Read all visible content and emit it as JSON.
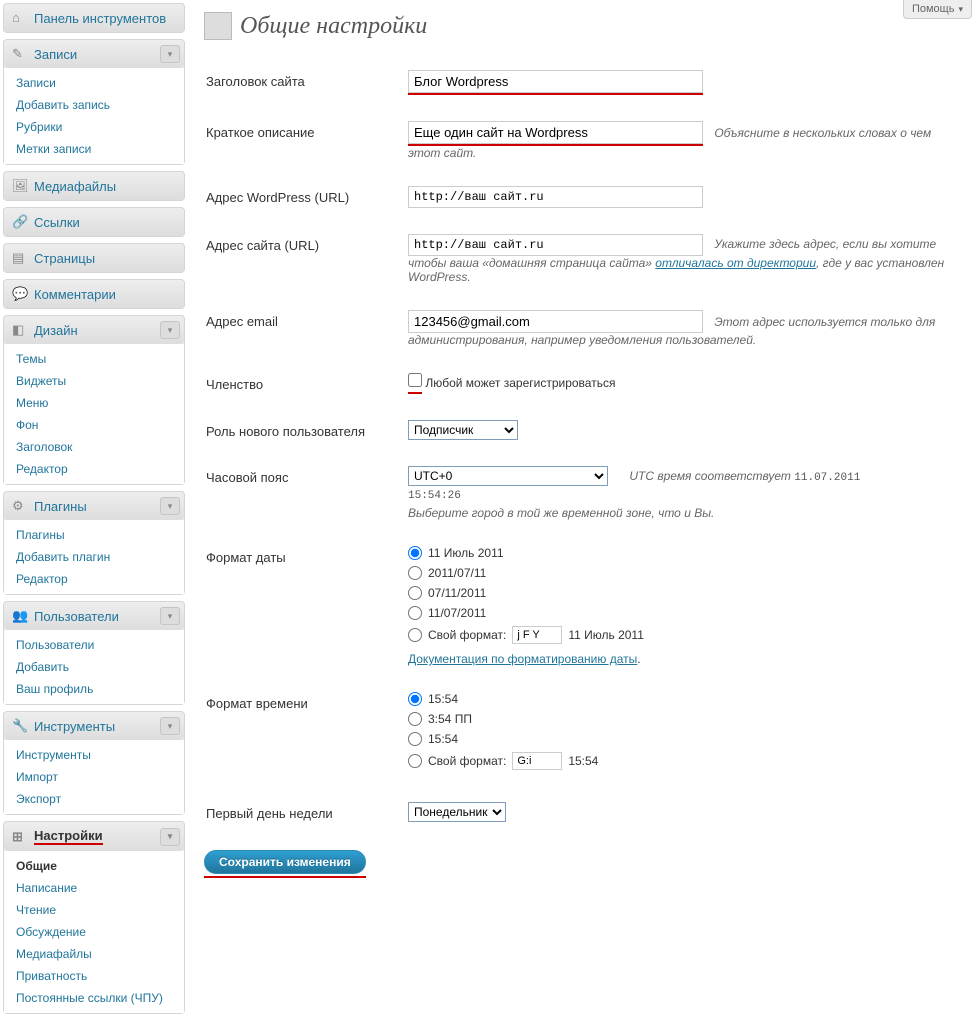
{
  "help_tab": "Помощь",
  "page_title": "Общие настройки",
  "sidebar": {
    "dashboard": "Панель инструментов",
    "posts": {
      "label": "Записи",
      "items": [
        "Записи",
        "Добавить запись",
        "Рубрики",
        "Метки записи"
      ]
    },
    "media": "Медиафайлы",
    "links": "Ссылки",
    "pages": "Страницы",
    "comments": "Комментарии",
    "appearance": {
      "label": "Дизайн",
      "items": [
        "Темы",
        "Виджеты",
        "Меню",
        "Фон",
        "Заголовок",
        "Редактор"
      ]
    },
    "plugins": {
      "label": "Плагины",
      "items": [
        "Плагины",
        "Добавить плагин",
        "Редактор"
      ]
    },
    "users": {
      "label": "Пользователи",
      "items": [
        "Пользователи",
        "Добавить",
        "Ваш профиль"
      ]
    },
    "tools": {
      "label": "Инструменты",
      "items": [
        "Инструменты",
        "Импорт",
        "Экспорт"
      ]
    },
    "settings": {
      "label": "Настройки",
      "items": [
        "Общие",
        "Написание",
        "Чтение",
        "Обсуждение",
        "Медиафайлы",
        "Приватность",
        "Постоянные ссылки (ЧПУ)"
      ]
    }
  },
  "form": {
    "site_title": {
      "label": "Заголовок сайта",
      "value": "Блог Wordpress"
    },
    "tagline": {
      "label": "Краткое описание",
      "value": "Еще один сайт на Wordpress",
      "desc": "Объясните в нескольких словах о чем этот сайт."
    },
    "wp_url": {
      "label": "Адрес WordPress (URL)",
      "value": "http://ваш сайт.ru"
    },
    "site_url": {
      "label": "Адрес сайта (URL)",
      "value": "http://ваш сайт.ru",
      "desc1": "Укажите здесь адрес, если вы хотите чтобы ваша «домашняя страница сайта» ",
      "desc_link": "отличалась от директории",
      "desc2": ", где у вас установлен WordPress."
    },
    "email": {
      "label": "Адрес email",
      "value": "123456@gmail.com",
      "desc": "Этот адрес используется только для администрирования, например уведомления пользователей."
    },
    "membership": {
      "label": "Членство",
      "checkbox_label": "Любой может зарегистрироваться"
    },
    "default_role": {
      "label": "Роль нового пользователя",
      "value": "Подписчик"
    },
    "timezone": {
      "label": "Часовой пояс",
      "value": "UTC+0",
      "utc_label": "UTC время соответствует",
      "utc_date": "11.07.2011",
      "utc_time": "15:54:26",
      "desc": "Выберите город в той же временной зоне, что и Вы."
    },
    "date_format": {
      "label": "Формат даты",
      "options": [
        "11 Июль 2011",
        "2011/07/11",
        "07/11/2011",
        "11/07/2011"
      ],
      "custom_label": "Свой формат:",
      "custom_value": "j F Y",
      "custom_preview": "11 Июль 2011",
      "doc_link": "Документация по форматированию даты"
    },
    "time_format": {
      "label": "Формат времени",
      "options": [
        "15:54",
        "3:54 ПП",
        "15:54"
      ],
      "custom_label": "Свой формат:",
      "custom_value": "G:i",
      "custom_preview": "15:54"
    },
    "week_start": {
      "label": "Первый день недели",
      "value": "Понедельник"
    },
    "save_button": "Сохранить изменения"
  }
}
